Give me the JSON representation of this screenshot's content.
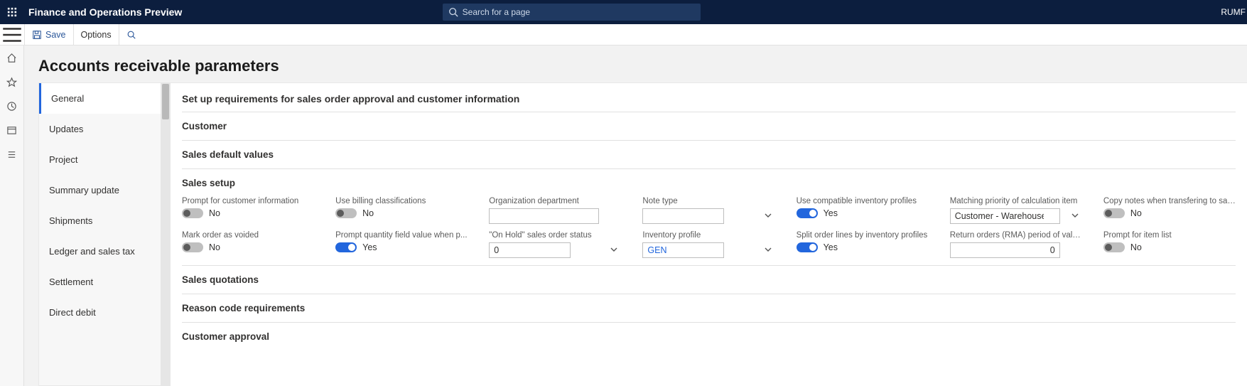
{
  "app": {
    "brand": "Finance and Operations Preview",
    "entity_short": "RUMF"
  },
  "search": {
    "placeholder": "Search for a page"
  },
  "actionbar": {
    "save": "Save",
    "options": "Options"
  },
  "page": {
    "title": "Accounts receivable parameters",
    "section_desc": "Set up requirements for sales order approval and customer information"
  },
  "vtabs": [
    "General",
    "Updates",
    "Project",
    "Summary update",
    "Shipments",
    "Ledger and sales tax",
    "Settlement",
    "Direct debit"
  ],
  "fasttabs": {
    "customer": "Customer",
    "sales_defaults": "Sales default values",
    "sales_setup": "Sales setup",
    "sales_quotations": "Sales quotations",
    "reason_codes": "Reason code requirements",
    "customer_approval": "Customer approval"
  },
  "fields": {
    "row1": {
      "prompt_customer": {
        "label": "Prompt for customer information",
        "value": false,
        "text_off": "No"
      },
      "billing_class": {
        "label": "Use billing classifications",
        "value": false,
        "text_off": "No"
      },
      "org_dept": {
        "label": "Organization department",
        "value": ""
      },
      "note_type": {
        "label": "Note type",
        "value": ""
      },
      "compat_inv": {
        "label": "Use compatible inventory profiles",
        "value": true,
        "text_on": "Yes"
      },
      "match_priority": {
        "label": "Matching priority of calculation item",
        "value": "Customer - Warehouse - item"
      },
      "copy_notes": {
        "label": "Copy notes when transfering to sale...",
        "value": false,
        "text_off": "No"
      }
    },
    "row2": {
      "mark_voided": {
        "label": "Mark order as voided",
        "value": false,
        "text_off": "No"
      },
      "prompt_qty": {
        "label": "Prompt quantity field value when p...",
        "value": true,
        "text_on": "Yes"
      },
      "on_hold": {
        "label": "\"On Hold\" sales order status",
        "value": "0"
      },
      "inv_profile": {
        "label": "Inventory profile",
        "value": "GEN"
      },
      "split_lines": {
        "label": "Split order lines by inventory profiles",
        "value": true,
        "text_on": "Yes"
      },
      "rma_valid": {
        "label": "Return orders (RMA) period of validity",
        "value": "0"
      },
      "prompt_item_list": {
        "label": "Prompt for item list",
        "value": false,
        "text_off": "No"
      }
    }
  }
}
